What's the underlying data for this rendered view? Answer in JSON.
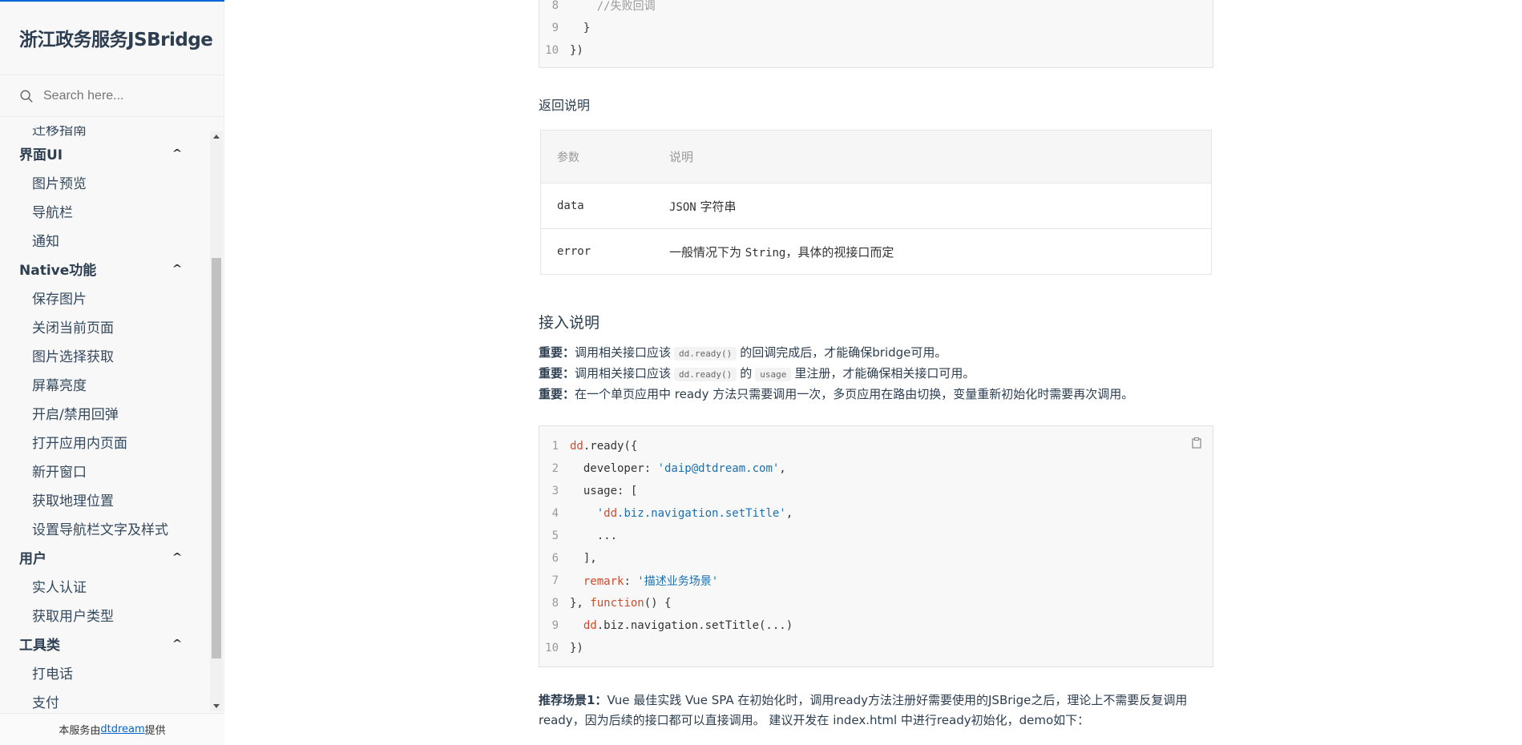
{
  "sidebar": {
    "brand": "浙江政务服务JSBridge",
    "search_placeholder": "Search here...",
    "nav": [
      {
        "type": "item",
        "label": "迁移指南",
        "cut": true
      },
      {
        "type": "group",
        "label": "界面UI"
      },
      {
        "type": "item",
        "label": "图片预览"
      },
      {
        "type": "item",
        "label": "导航栏"
      },
      {
        "type": "item",
        "label": "通知"
      },
      {
        "type": "group",
        "label": "Native功能"
      },
      {
        "type": "item",
        "label": "保存图片"
      },
      {
        "type": "item",
        "label": "关闭当前页面"
      },
      {
        "type": "item",
        "label": "图片选择获取"
      },
      {
        "type": "item",
        "label": "屏幕亮度"
      },
      {
        "type": "item",
        "label": "开启/禁用回弹"
      },
      {
        "type": "item",
        "label": "打开应用内页面"
      },
      {
        "type": "item",
        "label": "新开窗口"
      },
      {
        "type": "item",
        "label": "获取地理位置"
      },
      {
        "type": "item",
        "label": "设置导航栏文字及样式"
      },
      {
        "type": "group",
        "label": "用户"
      },
      {
        "type": "item",
        "label": "实人认证"
      },
      {
        "type": "item",
        "label": "获取用户类型"
      },
      {
        "type": "group",
        "label": "工具类"
      },
      {
        "type": "item",
        "label": "打电话"
      },
      {
        "type": "item",
        "label": "支付"
      }
    ],
    "footer_prefix": "本服务由 ",
    "footer_link": "dtdream",
    "footer_suffix": "提供"
  },
  "content": {
    "code1": [
      {
        "n": "8",
        "t": "    //失败回调"
      },
      {
        "n": "9",
        "t": "  }"
      },
      {
        "n": "10",
        "t": "})"
      }
    ],
    "return_heading": "返回说明",
    "table": {
      "headers": [
        "参数",
        "说明"
      ],
      "rows": [
        {
          "param": "data",
          "desc_code": "JSON",
          "desc": " 字符串"
        },
        {
          "param": "error",
          "desc_pre": "一般情况下为 ",
          "desc_code": "String",
          "desc": "，具体的视接口而定"
        }
      ]
    },
    "access_heading": "接入说明",
    "notes": {
      "label": "重要：",
      "line1_a": "调用相关接口应该",
      "line1_code": "dd.ready()",
      "line1_b": "的回调完成后，才能确保bridge可用。",
      "line2_a": "调用相关接口应该",
      "line2_code": "dd.ready()",
      "line2_b": "的",
      "line2_code2": "usage",
      "line2_c": "里注册，才能确保相关接口可用。",
      "line3": "在一个单页应用中 ready 方法只需要调用一次，多页应用在路由切换，变量重新初始化时需要再次调用。"
    },
    "code2": [
      {
        "n": "1",
        "t": "dd.ready({"
      },
      {
        "n": "2",
        "t": "  developer: 'daip@dtdream.com',"
      },
      {
        "n": "3",
        "t": "  usage: ["
      },
      {
        "n": "4",
        "t": "    'dd.biz.navigation.setTitle',"
      },
      {
        "n": "5",
        "t": "    ..."
      },
      {
        "n": "6",
        "t": "  ],"
      },
      {
        "n": "7",
        "t": "  remark: '描述业务场景'"
      },
      {
        "n": "8",
        "t": "}, function() {"
      },
      {
        "n": "9",
        "t": "  dd.biz.navigation.setTitle(...)"
      },
      {
        "n": "10",
        "t": "})"
      }
    ],
    "recommend_label": "推荐场景1：",
    "recommend_text": "Vue 最佳实践 Vue SPA 在初始化时，调用ready方法注册好需要使用的JSBrige之后，理论上不需要反复调用ready，因为后续的接口都可以直接调用。 建议开发在 index.html 中进行ready初始化，demo如下："
  },
  "icons": {
    "search": "search-icon",
    "copy": "copy-icon",
    "chevron": "chevron-up-icon"
  },
  "colors": {
    "accent": "#0366d6",
    "keyword": "#d14a2b",
    "string": "#1a6fb0"
  }
}
